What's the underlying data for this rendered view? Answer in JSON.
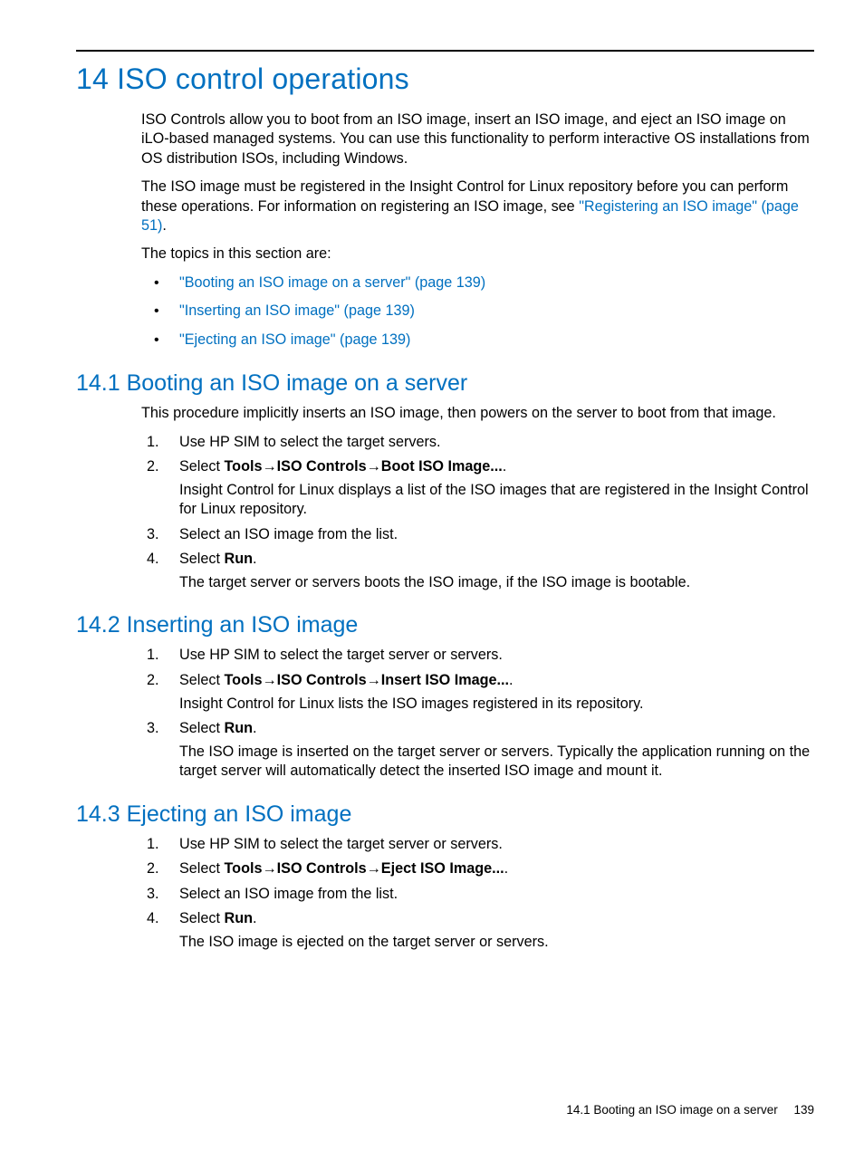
{
  "chapter_title": "14 ISO control operations",
  "intro_p1": "ISO Controls allow you to boot from an ISO image, insert an ISO image, and eject an ISO image on iLO-based managed systems. You can use this functionality to perform interactive OS installations from OS distribution ISOs, including Windows.",
  "intro_p2_pre": "The ISO image must be registered in the Insight Control for Linux repository before you can perform these operations. For information on registering an ISO image, see ",
  "intro_p2_link": "\"Registering an ISO image\" (page 51)",
  "intro_p2_post": ".",
  "intro_p3": "The topics in this section are:",
  "toc": [
    "\"Booting an ISO image on a server\" (page 139)",
    "\"Inserting an ISO image\" (page 139)",
    "\"Ejecting an ISO image\" (page 139)"
  ],
  "s1": {
    "title": "14.1 Booting an ISO image on a server",
    "intro": "This procedure implicitly inserts an ISO image, then powers on the server to boot from that image.",
    "step1": "Use HP SIM to select the target servers.",
    "step2_pre": "Select ",
    "step2_b1": "Tools",
    "step2_b2": "ISO Controls",
    "step2_b3": "Boot ISO Image...",
    "step2_post": ".",
    "step2_sub": "Insight Control for Linux displays a list of the ISO images that are registered in the Insight Control for Linux repository.",
    "step3": "Select an ISO image from the list.",
    "step4_pre": "Select ",
    "step4_b": "Run",
    "step4_post": ".",
    "step4_sub": "The target server or servers boots the ISO image, if the ISO image is bootable."
  },
  "s2": {
    "title": "14.2 Inserting an ISO image",
    "step1": "Use HP SIM to select the target server or servers.",
    "step2_pre": "Select ",
    "step2_b1": "Tools",
    "step2_b2": "ISO Controls",
    "step2_b3": "Insert ISO Image...",
    "step2_post": ".",
    "step2_sub": "Insight Control for Linux lists the ISO images registered in its repository.",
    "step3_pre": "Select ",
    "step3_b": "Run",
    "step3_post": ".",
    "step3_sub": "The ISO image is inserted on the target server or servers. Typically the application running on the target server will automatically detect the inserted ISO image and mount it."
  },
  "s3": {
    "title": "14.3 Ejecting an ISO image",
    "step1": "Use HP SIM to select the target server or servers.",
    "step2_pre": "Select ",
    "step2_b1": "Tools",
    "step2_b2": "ISO Controls",
    "step2_b3": "Eject ISO Image...",
    "step2_post": ".",
    "step3": "Select an ISO image from the list.",
    "step4_pre": "Select ",
    "step4_b": "Run",
    "step4_post": ".",
    "step4_sub": "The ISO image is ejected on the target server or servers."
  },
  "footer_text": "14.1 Booting an ISO image on a server",
  "footer_page": "139"
}
